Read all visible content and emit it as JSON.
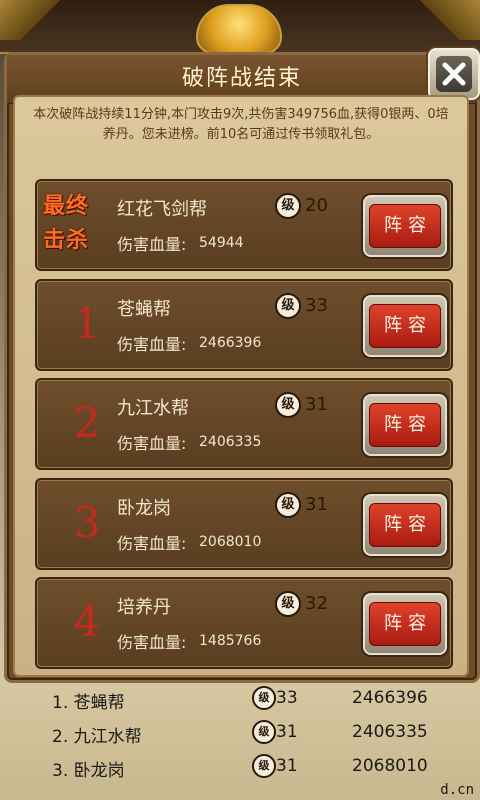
{
  "dialog": {
    "title": "破阵战结束",
    "summary": "本次破阵战持续11分钟,本门攻击9次,共伤害349756血,获得0银两、0培养丹。您未进榜。前10名可通过传书领取礼包。"
  },
  "labels": {
    "final_kill_line1": "最终",
    "final_kill_line2": "击杀",
    "level_icon": "级",
    "damage_label": "伤害血量:",
    "lineup_button": "阵容"
  },
  "rows": [
    {
      "rank": "",
      "name": "红花飞剑帮",
      "level": "20",
      "damage": "54944"
    },
    {
      "rank": "1",
      "name": "苍蝇帮",
      "level": "33",
      "damage": "2466396"
    },
    {
      "rank": "2",
      "name": "九江水帮",
      "level": "31",
      "damage": "2406335"
    },
    {
      "rank": "3",
      "name": "卧龙岗",
      "level": "31",
      "damage": "2068010"
    },
    {
      "rank": "4",
      "name": "培养丹",
      "level": "32",
      "damage": "1485766"
    }
  ],
  "background_list": [
    {
      "entry": "1. 苍蝇帮",
      "level": "33",
      "damage": "2466396"
    },
    {
      "entry": "2. 九江水帮",
      "level": "31",
      "damage": "2406335"
    },
    {
      "entry": "3. 卧龙岗",
      "level": "31",
      "damage": "2068010"
    }
  ],
  "watermark": "d.cn",
  "icons": {
    "close": "close-icon",
    "level": "level-badge-icon"
  },
  "colors": {
    "rank_red": "#c8281c",
    "button_red": "#c0301c",
    "final_orange": "#ff6a24"
  }
}
